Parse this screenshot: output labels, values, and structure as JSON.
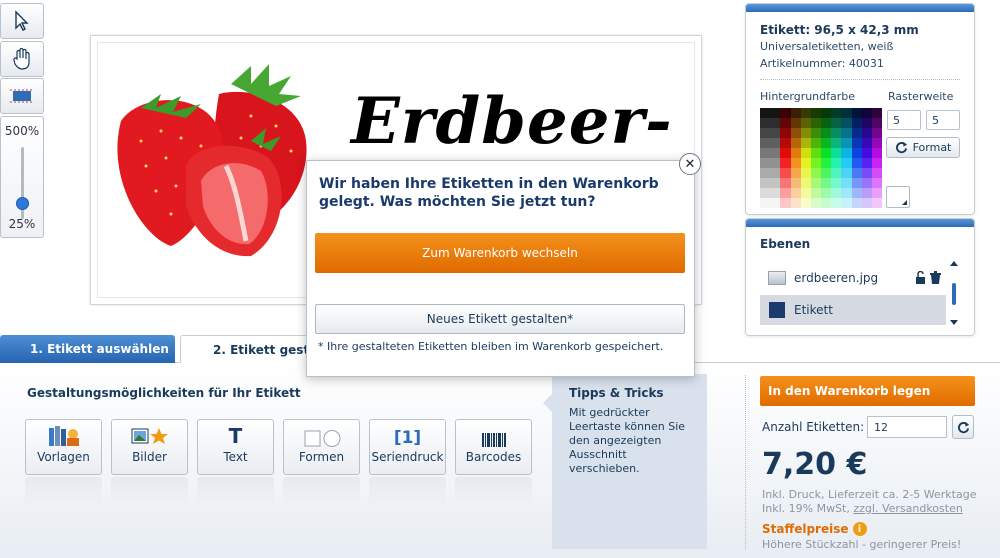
{
  "tools": {
    "zoom_max": "500%",
    "zoom_min": "25%",
    "zoom_level": 0.25
  },
  "label": {
    "title_text": "Erdbeer-",
    "image_name": "strawberries-image"
  },
  "info": {
    "size": "Etikett: 96,5 x 42,3 mm",
    "type": "Universaletiketten, weiß",
    "article": "Artikelnummer: 40031",
    "background_label": "Hintergrundfarbe",
    "grid_label": "Rasterweite",
    "grid_x": "5",
    "grid_y": "5",
    "format_button": "Format"
  },
  "layers": {
    "title": "Ebenen",
    "items": [
      {
        "name": "erdbeeren.jpg"
      },
      {
        "name": "Etikett"
      }
    ]
  },
  "tabs": [
    {
      "label": "1. Etikett auswählen"
    },
    {
      "label": "2. Etikett gestal"
    }
  ],
  "design": {
    "title": "Gestaltungsmöglichkeiten für Ihr Etikett",
    "tools": [
      {
        "label": "Vorlagen",
        "icon": "templates-icon"
      },
      {
        "label": "Bilder",
        "icon": "images-icon"
      },
      {
        "label": "Text",
        "icon": "text-icon"
      },
      {
        "label": "Formen",
        "icon": "shapes-icon"
      },
      {
        "label": "Seriendruck",
        "icon": "serial-print-icon"
      },
      {
        "label": "Barcodes",
        "icon": "barcode-icon"
      }
    ],
    "text_glyph": "T",
    "serial_glyph": "[1]"
  },
  "tips": {
    "title": "Tipps & Tricks",
    "body": "Mit gedrückter Leertaste können Sie den angezeigten Ausschnitt verschieben."
  },
  "order": {
    "cart_button": "In den Warenkorb legen",
    "qty_label": "Anzahl Etiketten:",
    "qty_value": "12",
    "price": "7,20 €",
    "incl1": "Inkl. Druck, Lieferzeit ca. 2-5 Werktage",
    "incl2_a": "Inkl. 19% MwSt, ",
    "incl2_link": "zzgl. Versandkosten",
    "staffel": "Staffelpreise",
    "staffel_sub": "Höhere Stückzahl - geringerer Preis!"
  },
  "modal": {
    "question": "Wir haben Ihre Etiketten in den Warenkorb gelegt. Was möchten Sie jetzt tun?",
    "primary": "Zum Warenkorb wechseln",
    "secondary": "Neues Etikett gestalten*",
    "note": "* Ihre gestalteten Etiketten bleiben im Warenkorb gespeichert.",
    "close_glyph": "✕"
  },
  "colors": {
    "accent_orange": "#e16b00",
    "primary_blue": "#2664b0",
    "text_navy": "#1a3a5c"
  }
}
